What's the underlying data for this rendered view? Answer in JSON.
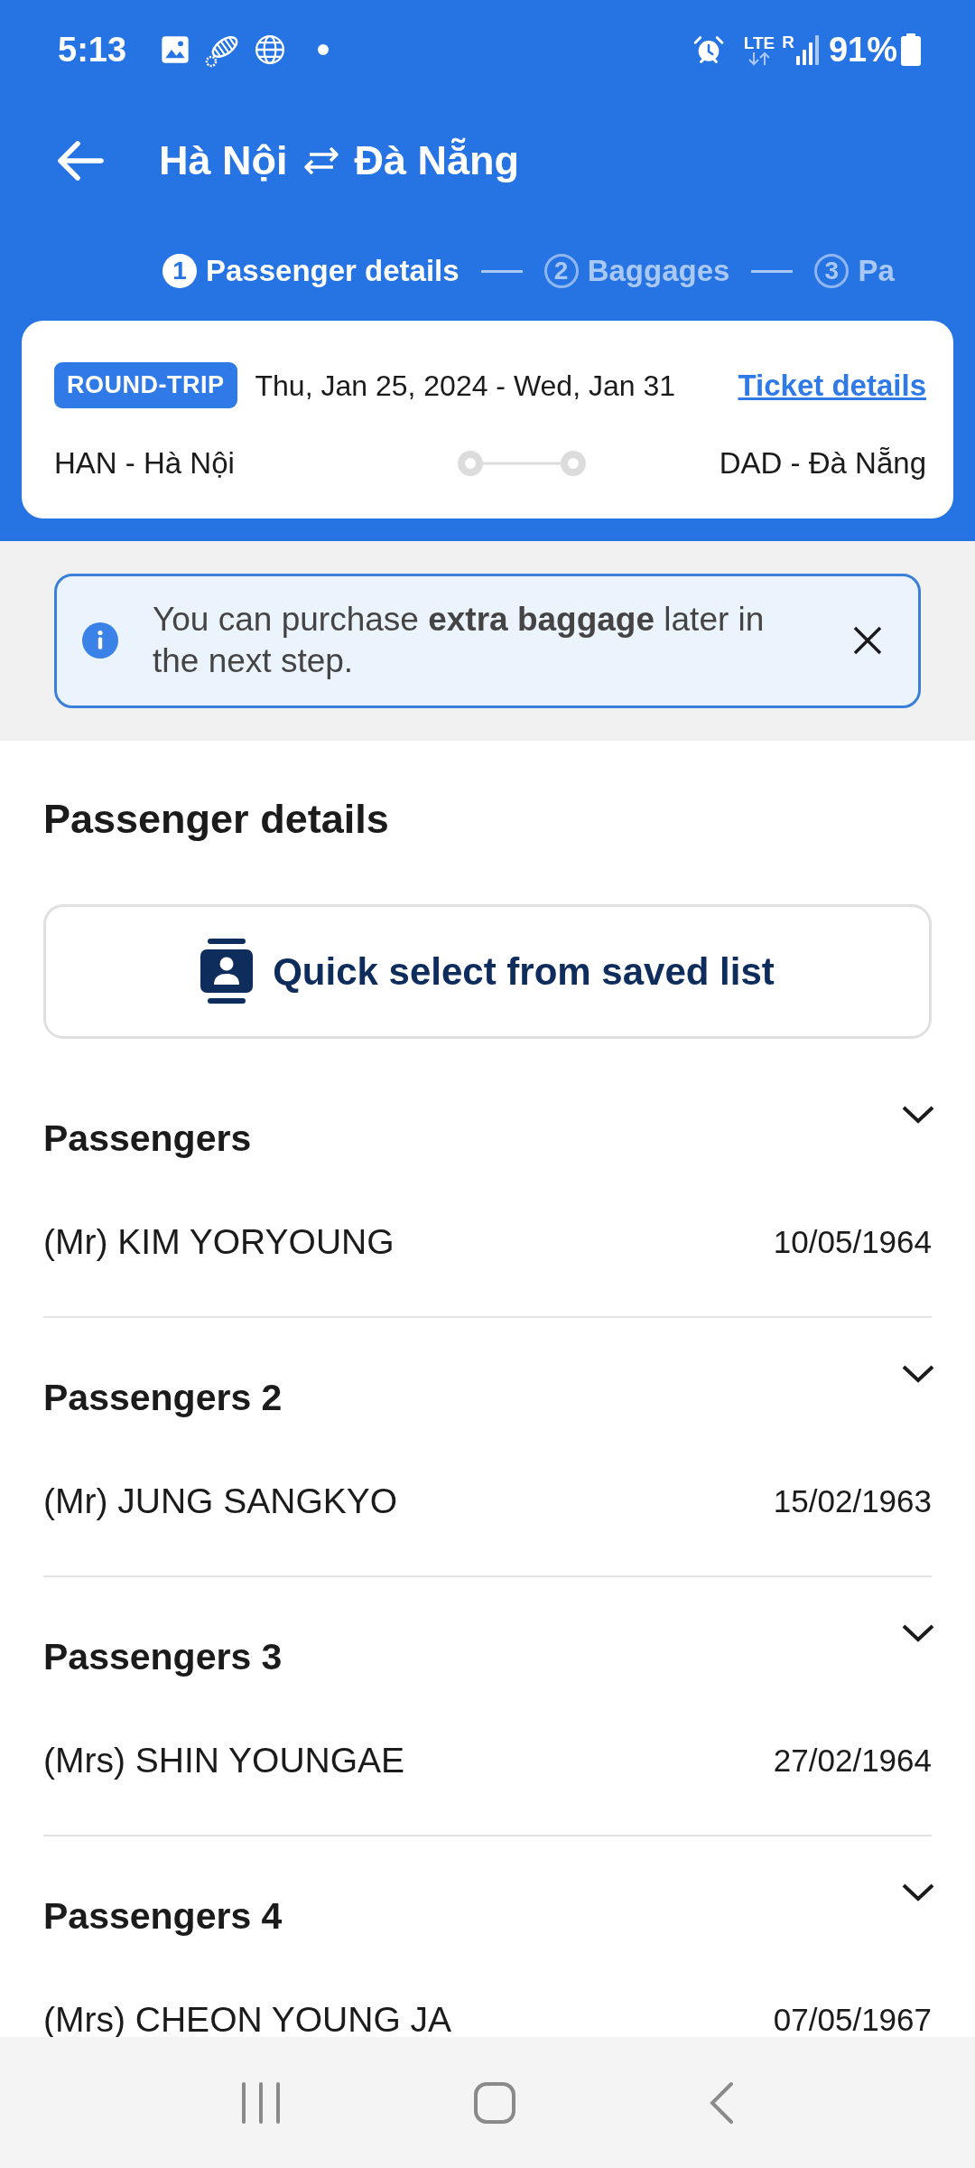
{
  "status_bar": {
    "time": "5:13",
    "network": "LTE",
    "roaming": "R",
    "battery": "91%"
  },
  "header": {
    "origin": "Hà Nội",
    "destination": "Đà Nẵng"
  },
  "steps": [
    {
      "number": "1",
      "label": "Passenger details",
      "selected": true
    },
    {
      "number": "2",
      "label": "Baggages",
      "selected": false
    },
    {
      "number": "3",
      "label": "Pa",
      "selected": false
    }
  ],
  "trip": {
    "type": "ROUND-TRIP",
    "dates": "Thu, Jan 25, 2024 - Wed, Jan 31",
    "link": "Ticket details",
    "origin": "HAN - Hà Nội",
    "destination": "DAD - Đà Nẵng"
  },
  "notice": {
    "message": "You can purchase **extra baggage** later in the next step."
  },
  "section_title": "Passenger details",
  "quick_select": {
    "label": "Quick select from saved list"
  },
  "passengers": [
    {
      "heading": "Passengers",
      "name": "(Mr) KIM YORYOUNG",
      "birth_date": "10/05/1964",
      "expanded": false
    },
    {
      "heading": "Passengers 2",
      "name": "(Mr) JUNG SANGKYO",
      "birth_date": "15/02/1963",
      "expanded": false
    },
    {
      "heading": "Passengers 3",
      "name": "(Mrs) SHIN YOUNGAE",
      "birth_date": "27/02/1964",
      "expanded": false
    },
    {
      "heading": "Passengers 4",
      "name": "(Mrs) CHEON YOUNG JA",
      "birth_date": "07/05/1967",
      "expanded": false
    }
  ]
}
